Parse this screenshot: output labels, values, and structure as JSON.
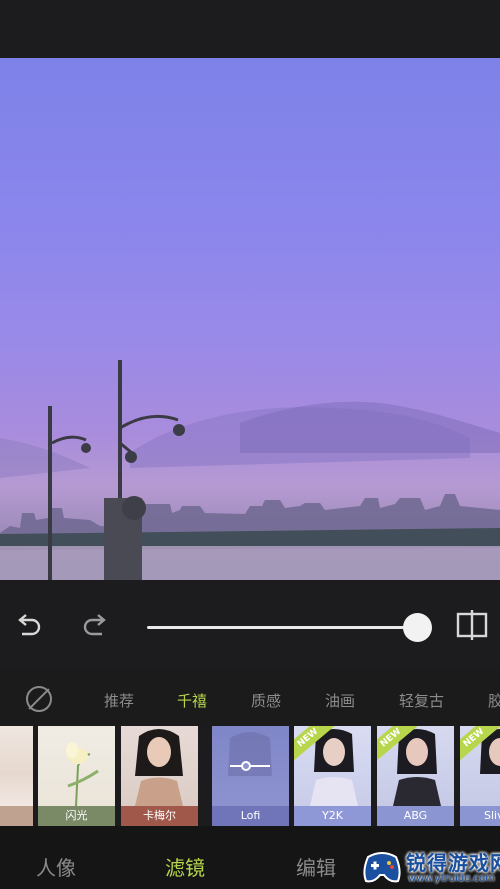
{
  "toolbar": {
    "undo_icon": "undo-icon",
    "redo_icon": "redo-icon",
    "compare_icon": "compare-icon",
    "intensity": 1.0
  },
  "filter_categories": [
    {
      "label": "推荐"
    },
    {
      "label": "千禧"
    },
    {
      "label": "质感"
    },
    {
      "label": "油画"
    },
    {
      "label": "轻复古"
    },
    {
      "label": "胶"
    }
  ],
  "active_category": "千禧",
  "filters": [
    {
      "label": "吉",
      "new": false
    },
    {
      "label": "闪光",
      "new": false
    },
    {
      "label": "卡梅尔",
      "new": false
    },
    {
      "label": "Lofi",
      "new": false,
      "selected": true
    },
    {
      "label": "Y2K",
      "new": true,
      "badge": "NEW"
    },
    {
      "label": "ABG",
      "new": true,
      "badge": "NEW"
    },
    {
      "label": "Sliv",
      "new": true,
      "badge": "NEW"
    }
  ],
  "bottom_nav": [
    {
      "label": "人像"
    },
    {
      "label": "滤镜"
    },
    {
      "label": "编辑"
    }
  ],
  "active_nav": "滤镜",
  "watermark": {
    "title": "锐得游戏网",
    "url": "www.ytruide.com"
  },
  "colors": {
    "accent": "#b7d64b",
    "background": "#1c1c1e"
  }
}
